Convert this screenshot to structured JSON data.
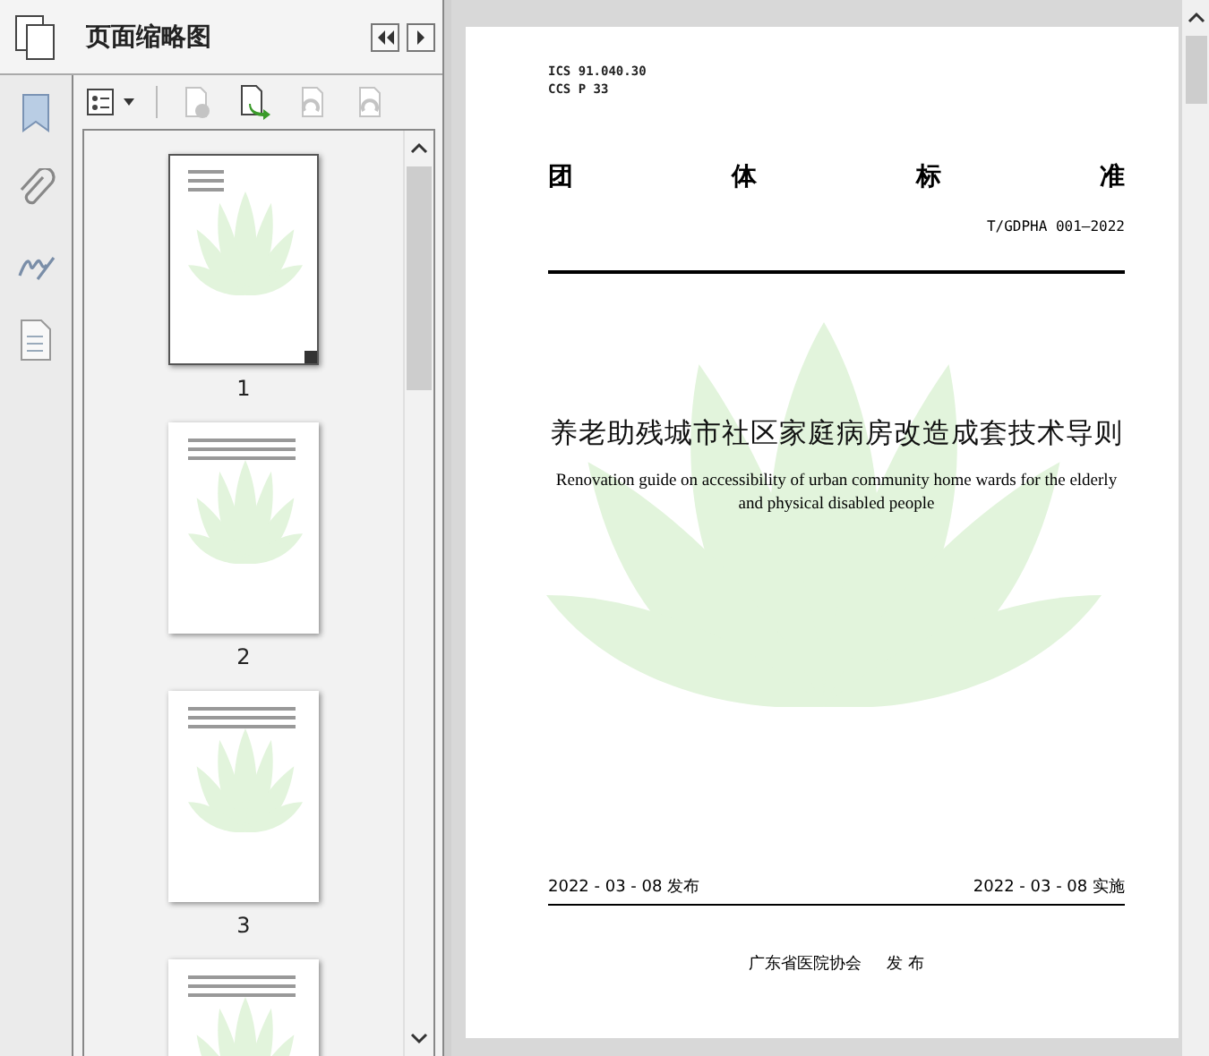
{
  "panel": {
    "title": "页面缩略图"
  },
  "toolbar": [
    {
      "kind": "options",
      "disabled": false
    },
    {
      "kind": "delete",
      "disabled": true
    },
    {
      "kind": "insert",
      "disabled": false
    },
    {
      "kind": "rotate-left",
      "disabled": true
    },
    {
      "kind": "rotate-right",
      "disabled": true
    }
  ],
  "thumbnails": [
    {
      "label": "1",
      "selected": true
    },
    {
      "label": "2",
      "selected": false
    },
    {
      "label": "3",
      "selected": false
    },
    {
      "selected": false
    }
  ],
  "document": {
    "ics": "ICS 91.040.30",
    "ccs": "CCS P 33",
    "heading": [
      "团",
      "体",
      "标",
      "准"
    ],
    "standard_number": "T/GDPHA 001—2022",
    "title_zh": "养老助残城市社区家庭病房改造成套技术导则",
    "title_en": "Renovation guide on accessibility of urban community home wards for the elderly and physical disabled people",
    "publish_date": "2022 - 03 - 08 发布",
    "effective_date": "2022 - 03 - 08 实施",
    "publisher": "广东省医院协会",
    "publisher_action": "发 布"
  }
}
